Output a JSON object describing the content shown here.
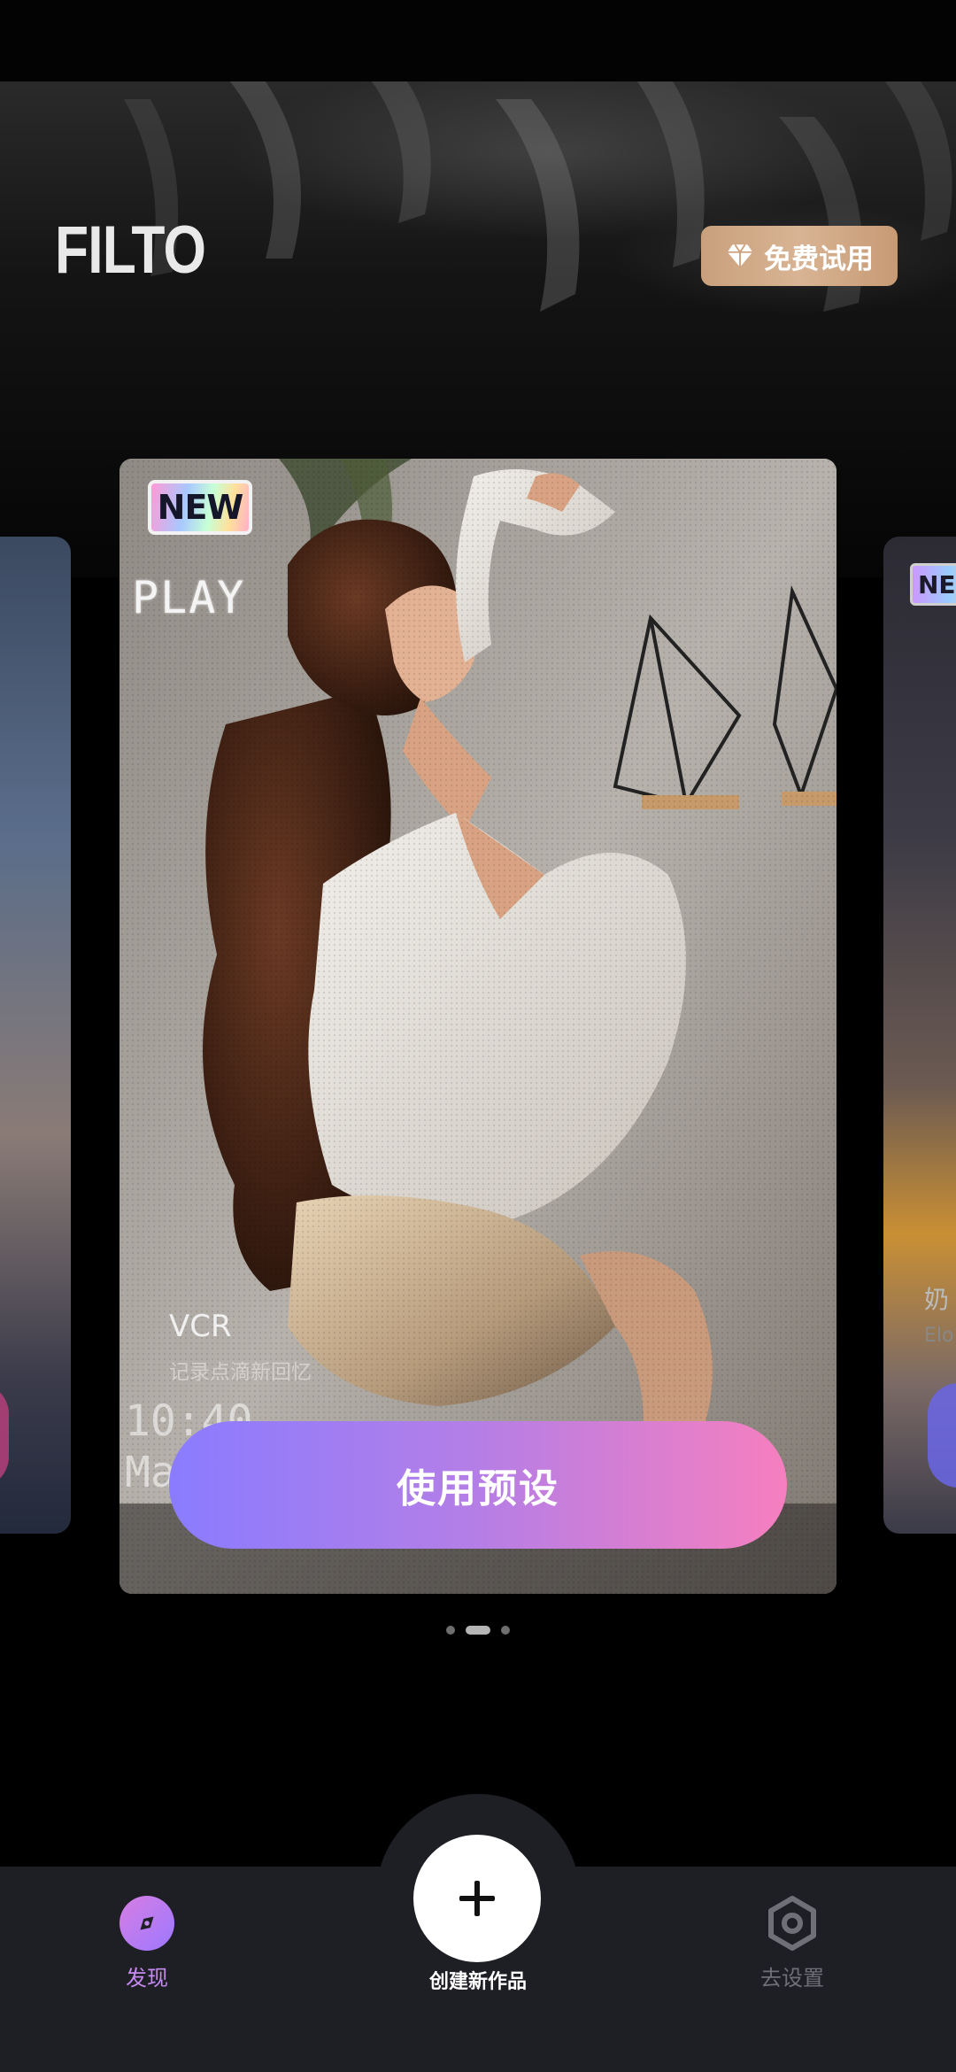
{
  "app": {
    "logo": "FILTO"
  },
  "header": {
    "trial_label": "免费试用",
    "trial_icon": "diamond-icon"
  },
  "carousel": {
    "main_card": {
      "badge": "NEW",
      "overlay_text": "PLAY",
      "preset_name": "VCR",
      "preset_description": "记录点滴新回忆",
      "timestamp_line1": "10:40",
      "timestamp_line2": "Ma"
    },
    "right_card": {
      "badge": "NE",
      "name_fragment": "奶",
      "desc_fragment": "Elo"
    },
    "use_preset_label": "使用预设",
    "pager": {
      "count": 3,
      "active_index": 1
    }
  },
  "tabbar": {
    "discover": {
      "label": "发现",
      "icon": "compass-icon"
    },
    "create": {
      "label": "创建新作品",
      "icon": "plus-icon"
    },
    "settings": {
      "label": "去设置",
      "icon": "gear-icon"
    }
  },
  "colors": {
    "accent_gradient_start": "#8a7cff",
    "accent_gradient_end": "#f67fbf",
    "trial_gold": "#d8b494",
    "tabbar_bg": "#1e1e25",
    "active_tab": "#c48af0",
    "inactive_tab": "#6f6f78"
  }
}
